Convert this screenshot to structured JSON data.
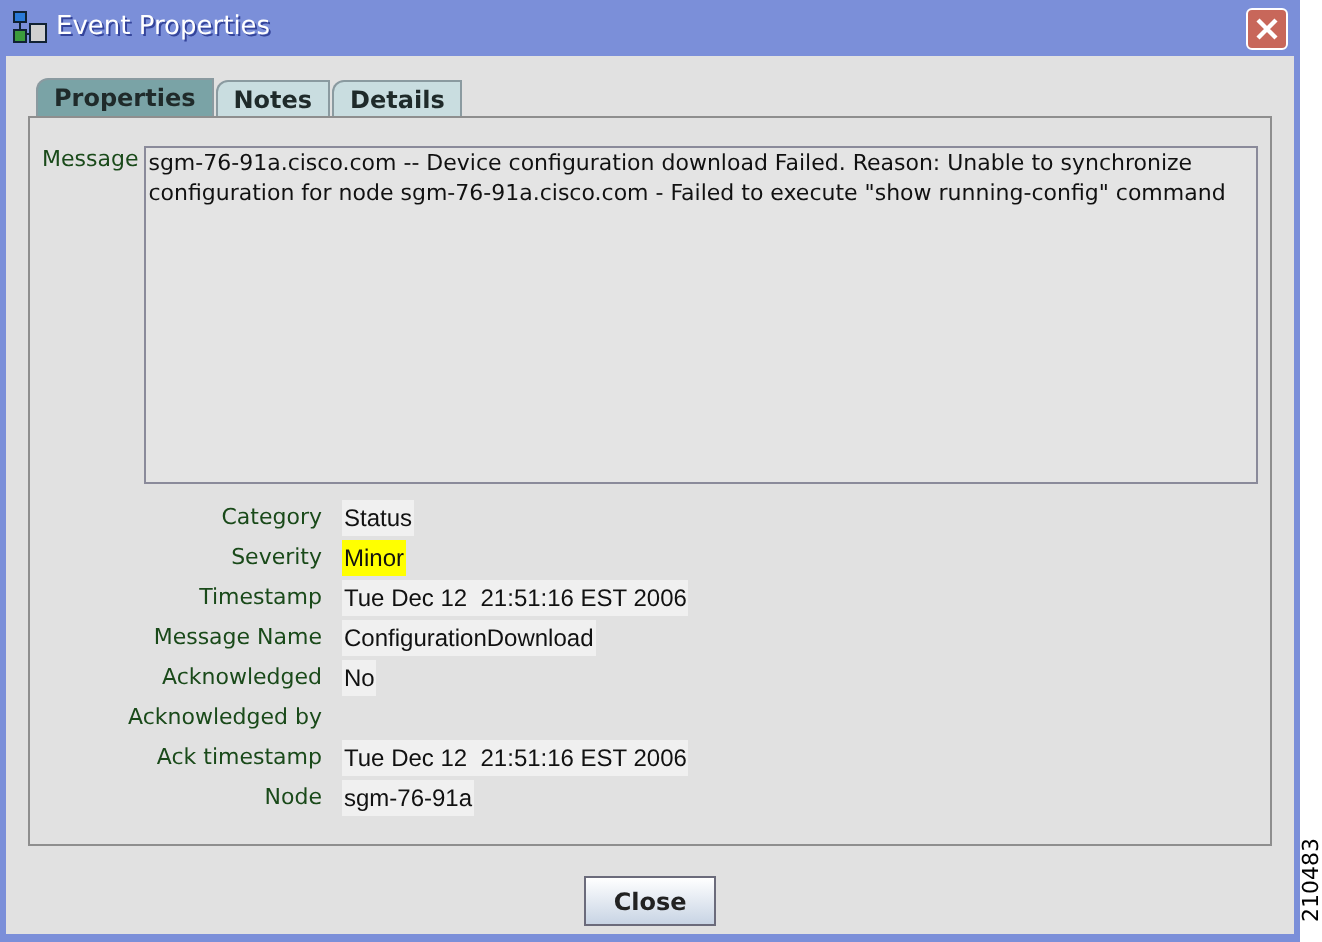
{
  "window": {
    "title": "Event Properties"
  },
  "tabs": [
    {
      "label": "Properties",
      "selected": true
    },
    {
      "label": "Notes",
      "selected": false
    },
    {
      "label": "Details",
      "selected": false
    }
  ],
  "message": {
    "label": "Message",
    "value": "sgm-76-91a.cisco.com -- Device configuration download Failed. Reason: Unable to synchronize configuration for node sgm-76-91a.cisco.com - Failed to execute \"show running-config\" command"
  },
  "fields": [
    {
      "label": "Category",
      "value": "Status"
    },
    {
      "label": "Severity",
      "value": "Minor",
      "color": "#ffff00"
    },
    {
      "label": "Timestamp",
      "value": "Tue Dec 12  21:51:16 EST 2006"
    },
    {
      "label": "Message Name",
      "value": "ConfigurationDownload"
    },
    {
      "label": "Acknowledged",
      "value": "No"
    },
    {
      "label": "Acknowledged by"
    },
    {
      "label": "Ack timestamp",
      "value": "Tue Dec 12  21:51:16 EST 2006"
    },
    {
      "label": "Node",
      "value": "sgm-76-91a"
    }
  ],
  "buttons": [
    "Close"
  ],
  "figure_number": "210483"
}
